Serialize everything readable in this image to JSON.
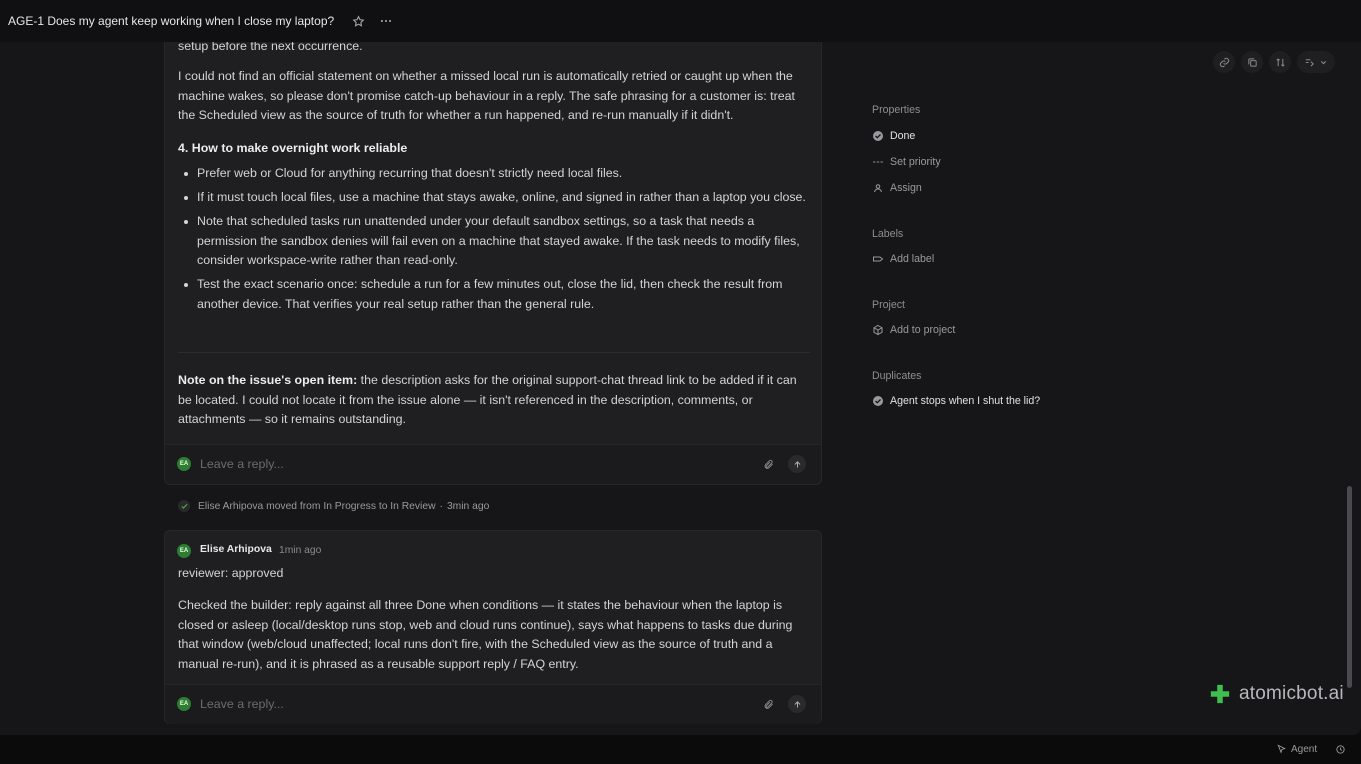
{
  "topbar": {
    "title": "AGE-1 Does my agent keep working when I close my laptop?",
    "star_icon": "star-icon",
    "more_icon": "more-icon"
  },
  "comment1": {
    "lines_top": "setup before the next occurrence.",
    "para_official": "I could not find an official statement on whether a missed local run is automatically retried or caught up when the machine wakes, so please don't promise catch-up behaviour in a reply. The safe phrasing for a customer is: treat the Scheduled view as the source of truth for whether a run happened, and re-run manually if it didn't.",
    "heading": "4. How to make overnight work reliable",
    "bullets": [
      "Prefer web or Cloud for anything recurring that doesn't strictly need local files.",
      "If it must touch local files, use a machine that stays awake, online, and signed in rather than a laptop you close.",
      "Note that scheduled tasks run unattended under your default sandbox settings, so a task that needs a permission the sandbox denies will fail even on a machine that stayed awake. If the task needs to modify files, consider workspace-write rather than read-only.",
      "Test the exact scenario once: schedule a run for a few minutes out, close the lid, then check the result from another device. That verifies your real setup rather than the general rule."
    ],
    "note_label": "Note on the issue's open item:",
    "note_text": " the description asks for the original support-chat thread link to be added if it can be located. I could not locate it from the issue alone — it isn't referenced in the description, comments, or attachments — so it remains outstanding.",
    "reply_placeholder": "Leave a reply...",
    "avatar_initials": "EA"
  },
  "activity": {
    "text": "Elise Arhipova moved from In Progress to In Review",
    "sep": "·",
    "time": "3min ago"
  },
  "comment2": {
    "author": "Elise Arhipova",
    "time": "1min ago",
    "line1": "reviewer: approved",
    "para": "Checked the builder: reply against all three Done when conditions — it states the behaviour when the laptop is closed or asleep (local/desktop runs stop, web and cloud runs continue), says what happens to tasks due during that window (web/cloud unaffected; local runs don't fire, with the Scheduled view as the source of truth and a manual re-run), and it is phrased as a reusable support reply / FAQ entry.",
    "reply_placeholder": "Leave a reply...",
    "avatar_initials": "EA"
  },
  "sidebar": {
    "properties_title": "Properties",
    "status": "Done",
    "priority": "Set priority",
    "assign": "Assign",
    "labels_title": "Labels",
    "add_label": "Add label",
    "project_title": "Project",
    "add_project": "Add to project",
    "duplicates_title": "Duplicates",
    "duplicate_item": "Agent stops when I shut the lid?"
  },
  "footer": {
    "brand": "atomicbot.ai",
    "agent": "Agent"
  },
  "colors": {
    "accent_green": "#2e7d32",
    "brand_green": "#3fbf4f"
  }
}
